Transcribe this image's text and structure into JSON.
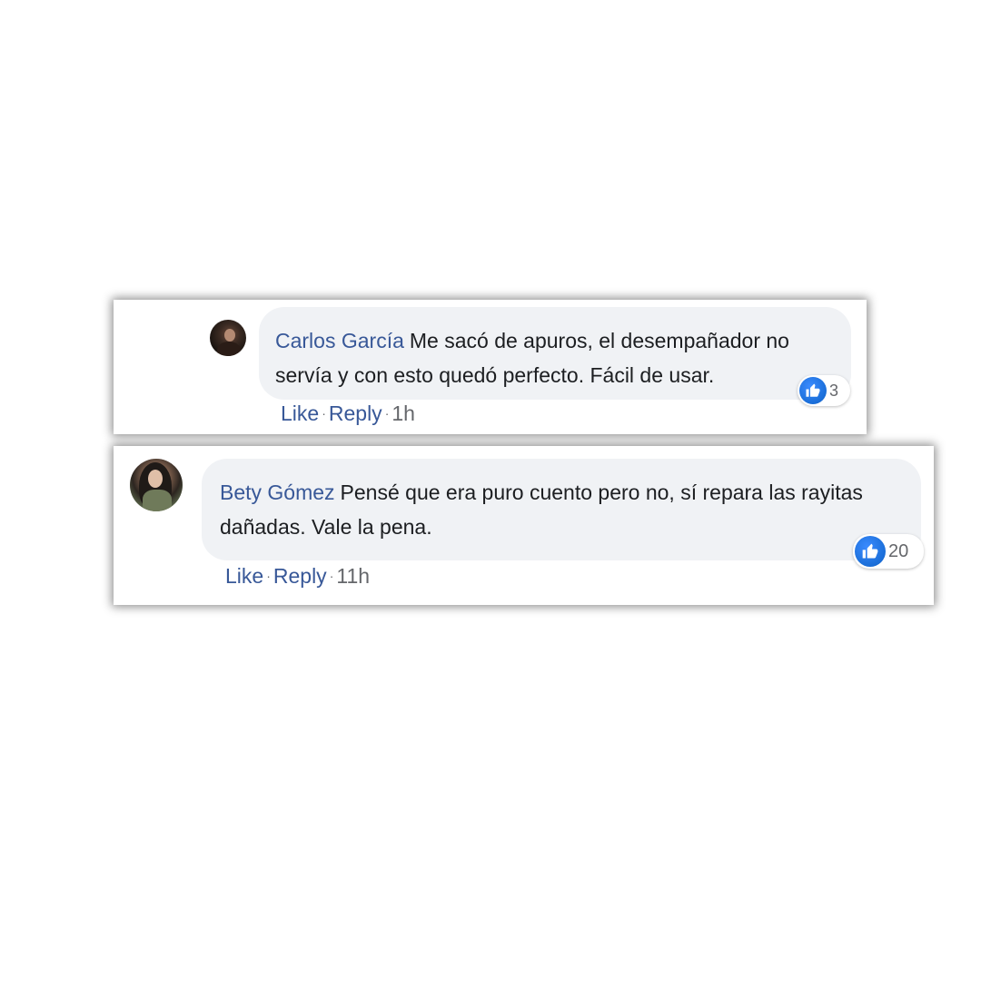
{
  "comments": [
    {
      "author": "Carlos García",
      "text": "Me sacó de apuros, el desempañador no servía y con esto quedó perfecto. Fácil de usar.",
      "reaction_count": "3",
      "like_label": "Like",
      "reply_label": "Reply",
      "separator": "·",
      "time": "1h"
    },
    {
      "author": "Bety Gómez",
      "text": "Pensé que era puro cuento pero no, sí repara las rayitas dañadas. Vale la pena.",
      "reaction_count": "20",
      "like_label": "Like",
      "reply_label": "Reply",
      "separator": "·",
      "time": "11h"
    }
  ],
  "colors": {
    "author_link": "#385898",
    "bubble_bg": "#f0f2f5",
    "like_blue": "#1a6ed8",
    "meta_gray": "#65676b"
  },
  "icons": {
    "reaction": "thumbs-up-icon"
  }
}
